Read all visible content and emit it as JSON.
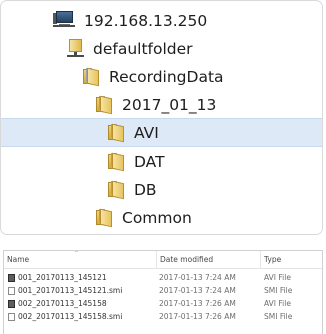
{
  "tree": {
    "nodes": [
      {
        "label": "192.168.13.250",
        "icon": "computer-icon",
        "level": 0,
        "selected": false
      },
      {
        "label": "defaultfolder",
        "icon": "network-share-icon",
        "level": 1,
        "selected": false
      },
      {
        "label": "RecordingData",
        "icon": "folder-icon",
        "level": 2,
        "selected": false
      },
      {
        "label": "2017_01_13",
        "icon": "folder-icon",
        "level": 3,
        "selected": false
      },
      {
        "label": "AVI",
        "icon": "folder-icon",
        "level": 4,
        "selected": true
      },
      {
        "label": "DAT",
        "icon": "folder-icon",
        "level": 4,
        "selected": false
      },
      {
        "label": "DB",
        "icon": "folder-icon",
        "level": 4,
        "selected": false
      },
      {
        "label": "Common",
        "icon": "folder-icon",
        "level": 3,
        "selected": false
      }
    ],
    "selected_color": "#dde9f6"
  },
  "file_list": {
    "columns": {
      "name": "Name",
      "date": "Date modified",
      "type": "Type"
    },
    "rows": [
      {
        "name": "001_20170113_145121",
        "date": "2017-01-13 7:24 AM",
        "type": "AVI File",
        "icon": "video-file-icon"
      },
      {
        "name": "001_20170113_145121.smi",
        "date": "2017-01-13 7:24 AM",
        "type": "SMI File",
        "icon": "text-file-icon"
      },
      {
        "name": "002_20170113_145158",
        "date": "2017-01-13 7:26 AM",
        "type": "AVI File",
        "icon": "video-file-icon"
      },
      {
        "name": "002_20170113_145158.smi",
        "date": "2017-01-13 7:26 AM",
        "type": "SMI File",
        "icon": "text-file-icon"
      }
    ]
  }
}
